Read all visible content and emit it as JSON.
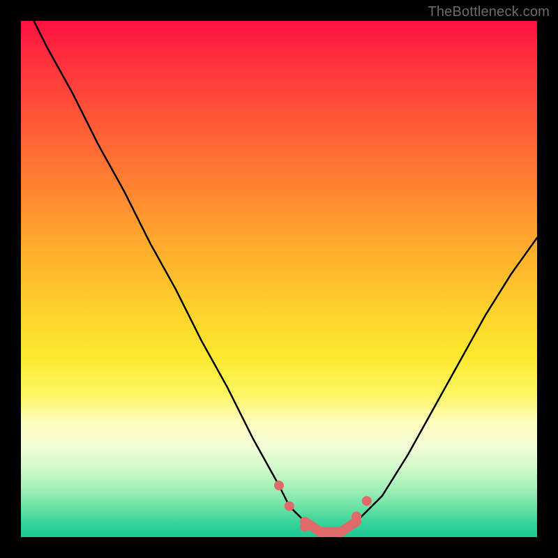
{
  "watermark": "TheBottleneck.com",
  "chart_data": {
    "type": "line",
    "title": "",
    "xlabel": "",
    "ylabel": "",
    "xlim": [
      0,
      100
    ],
    "ylim": [
      0,
      100
    ],
    "series": [
      {
        "name": "bottleneck-curve",
        "x": [
          0,
          5,
          10,
          15,
          20,
          25,
          30,
          35,
          40,
          45,
          50,
          52,
          55,
          58,
          62,
          65,
          70,
          75,
          80,
          85,
          90,
          95,
          100
        ],
        "values": [
          105,
          95,
          86,
          76,
          67,
          57,
          48,
          38,
          29,
          19,
          10,
          6,
          3,
          1,
          1,
          3,
          8,
          16,
          25,
          34,
          43,
          51,
          58
        ]
      }
    ],
    "annotations": [
      {
        "name": "left-marker-1",
        "x": 50,
        "y": 10
      },
      {
        "name": "left-marker-2",
        "x": 52,
        "y": 6
      },
      {
        "name": "floor-marker-1",
        "x": 55,
        "y": 2
      },
      {
        "name": "floor-marker-2",
        "x": 58,
        "y": 1
      },
      {
        "name": "floor-marker-3",
        "x": 60,
        "y": 1
      },
      {
        "name": "floor-marker-4",
        "x": 62,
        "y": 1
      },
      {
        "name": "right-marker-1",
        "x": 65,
        "y": 4
      },
      {
        "name": "right-marker-2",
        "x": 67,
        "y": 7
      }
    ],
    "marker_color": "#e06a6a",
    "curve_color": "#000000",
    "background_gradient": [
      "#ff1041",
      "#ffa62e",
      "#fbe92f",
      "#fefdc0",
      "#1bc993"
    ]
  }
}
